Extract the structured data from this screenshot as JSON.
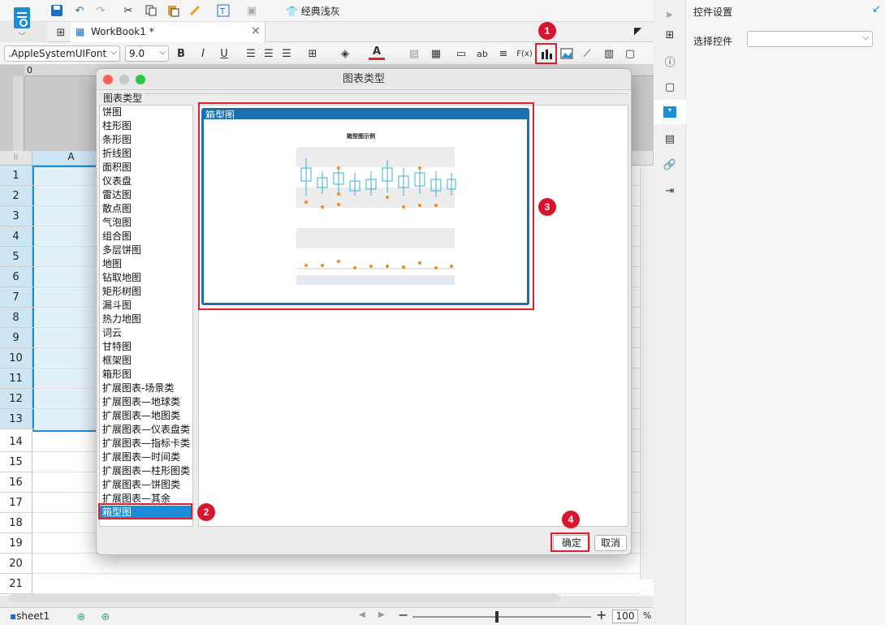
{
  "toolbar": {
    "theme_label": "经典浅灰"
  },
  "tab": {
    "label": "WorkBook1 *"
  },
  "format": {
    "font": ".AppleSystemUIFont",
    "size": "9.0",
    "bold": "B",
    "italic": "I",
    "underline": "U",
    "text_ab": "ab",
    "formula": "F(x)",
    "text_color": "#e0202d"
  },
  "ruler": {
    "zero": "0"
  },
  "sheet": {
    "col_a": "A",
    "rows": [
      "1",
      "2",
      "3",
      "4",
      "5",
      "6",
      "7",
      "8",
      "9",
      "10",
      "11",
      "12",
      "13",
      "14",
      "15",
      "16",
      "17",
      "18",
      "19",
      "20",
      "21"
    ]
  },
  "right_panel": {
    "title": "控件设置",
    "select_label": "选择控件"
  },
  "status": {
    "sheet_tab": "sheet1",
    "zoom": "100",
    "percent": "%"
  },
  "dialog": {
    "title": "图表类型",
    "group_label": "图表类型",
    "chart_types": [
      "饼图",
      "柱形图",
      "条形图",
      "折线图",
      "面积图",
      "仪表盘",
      "雷达图",
      "散点图",
      "气泡图",
      "组合图",
      "多层饼图",
      "地图",
      "钻取地图",
      "矩形树图",
      "漏斗图",
      "热力地图",
      "词云",
      "甘特图",
      "框架图",
      "箱形图",
      "扩展图表-场景类",
      "扩展图表—地球类",
      "扩展图表—地图类",
      "扩展图表—仪表盘类",
      "扩展图表—指标卡类",
      "扩展图表—时间类",
      "扩展图表—柱形图类",
      "扩展图表—饼图类",
      "扩展图表—其余",
      "箱型图"
    ],
    "selected_index": 29,
    "preview_label": "箱型图",
    "preview_title": "箱型图示例",
    "ok": "确定",
    "cancel": "取消"
  },
  "badges": {
    "b1": "1",
    "b2": "2",
    "b3": "3",
    "b4": "4"
  },
  "colors": {
    "accent": "#1a8cd8",
    "highlight": "#e0202d",
    "selection": "#cde6f3"
  }
}
